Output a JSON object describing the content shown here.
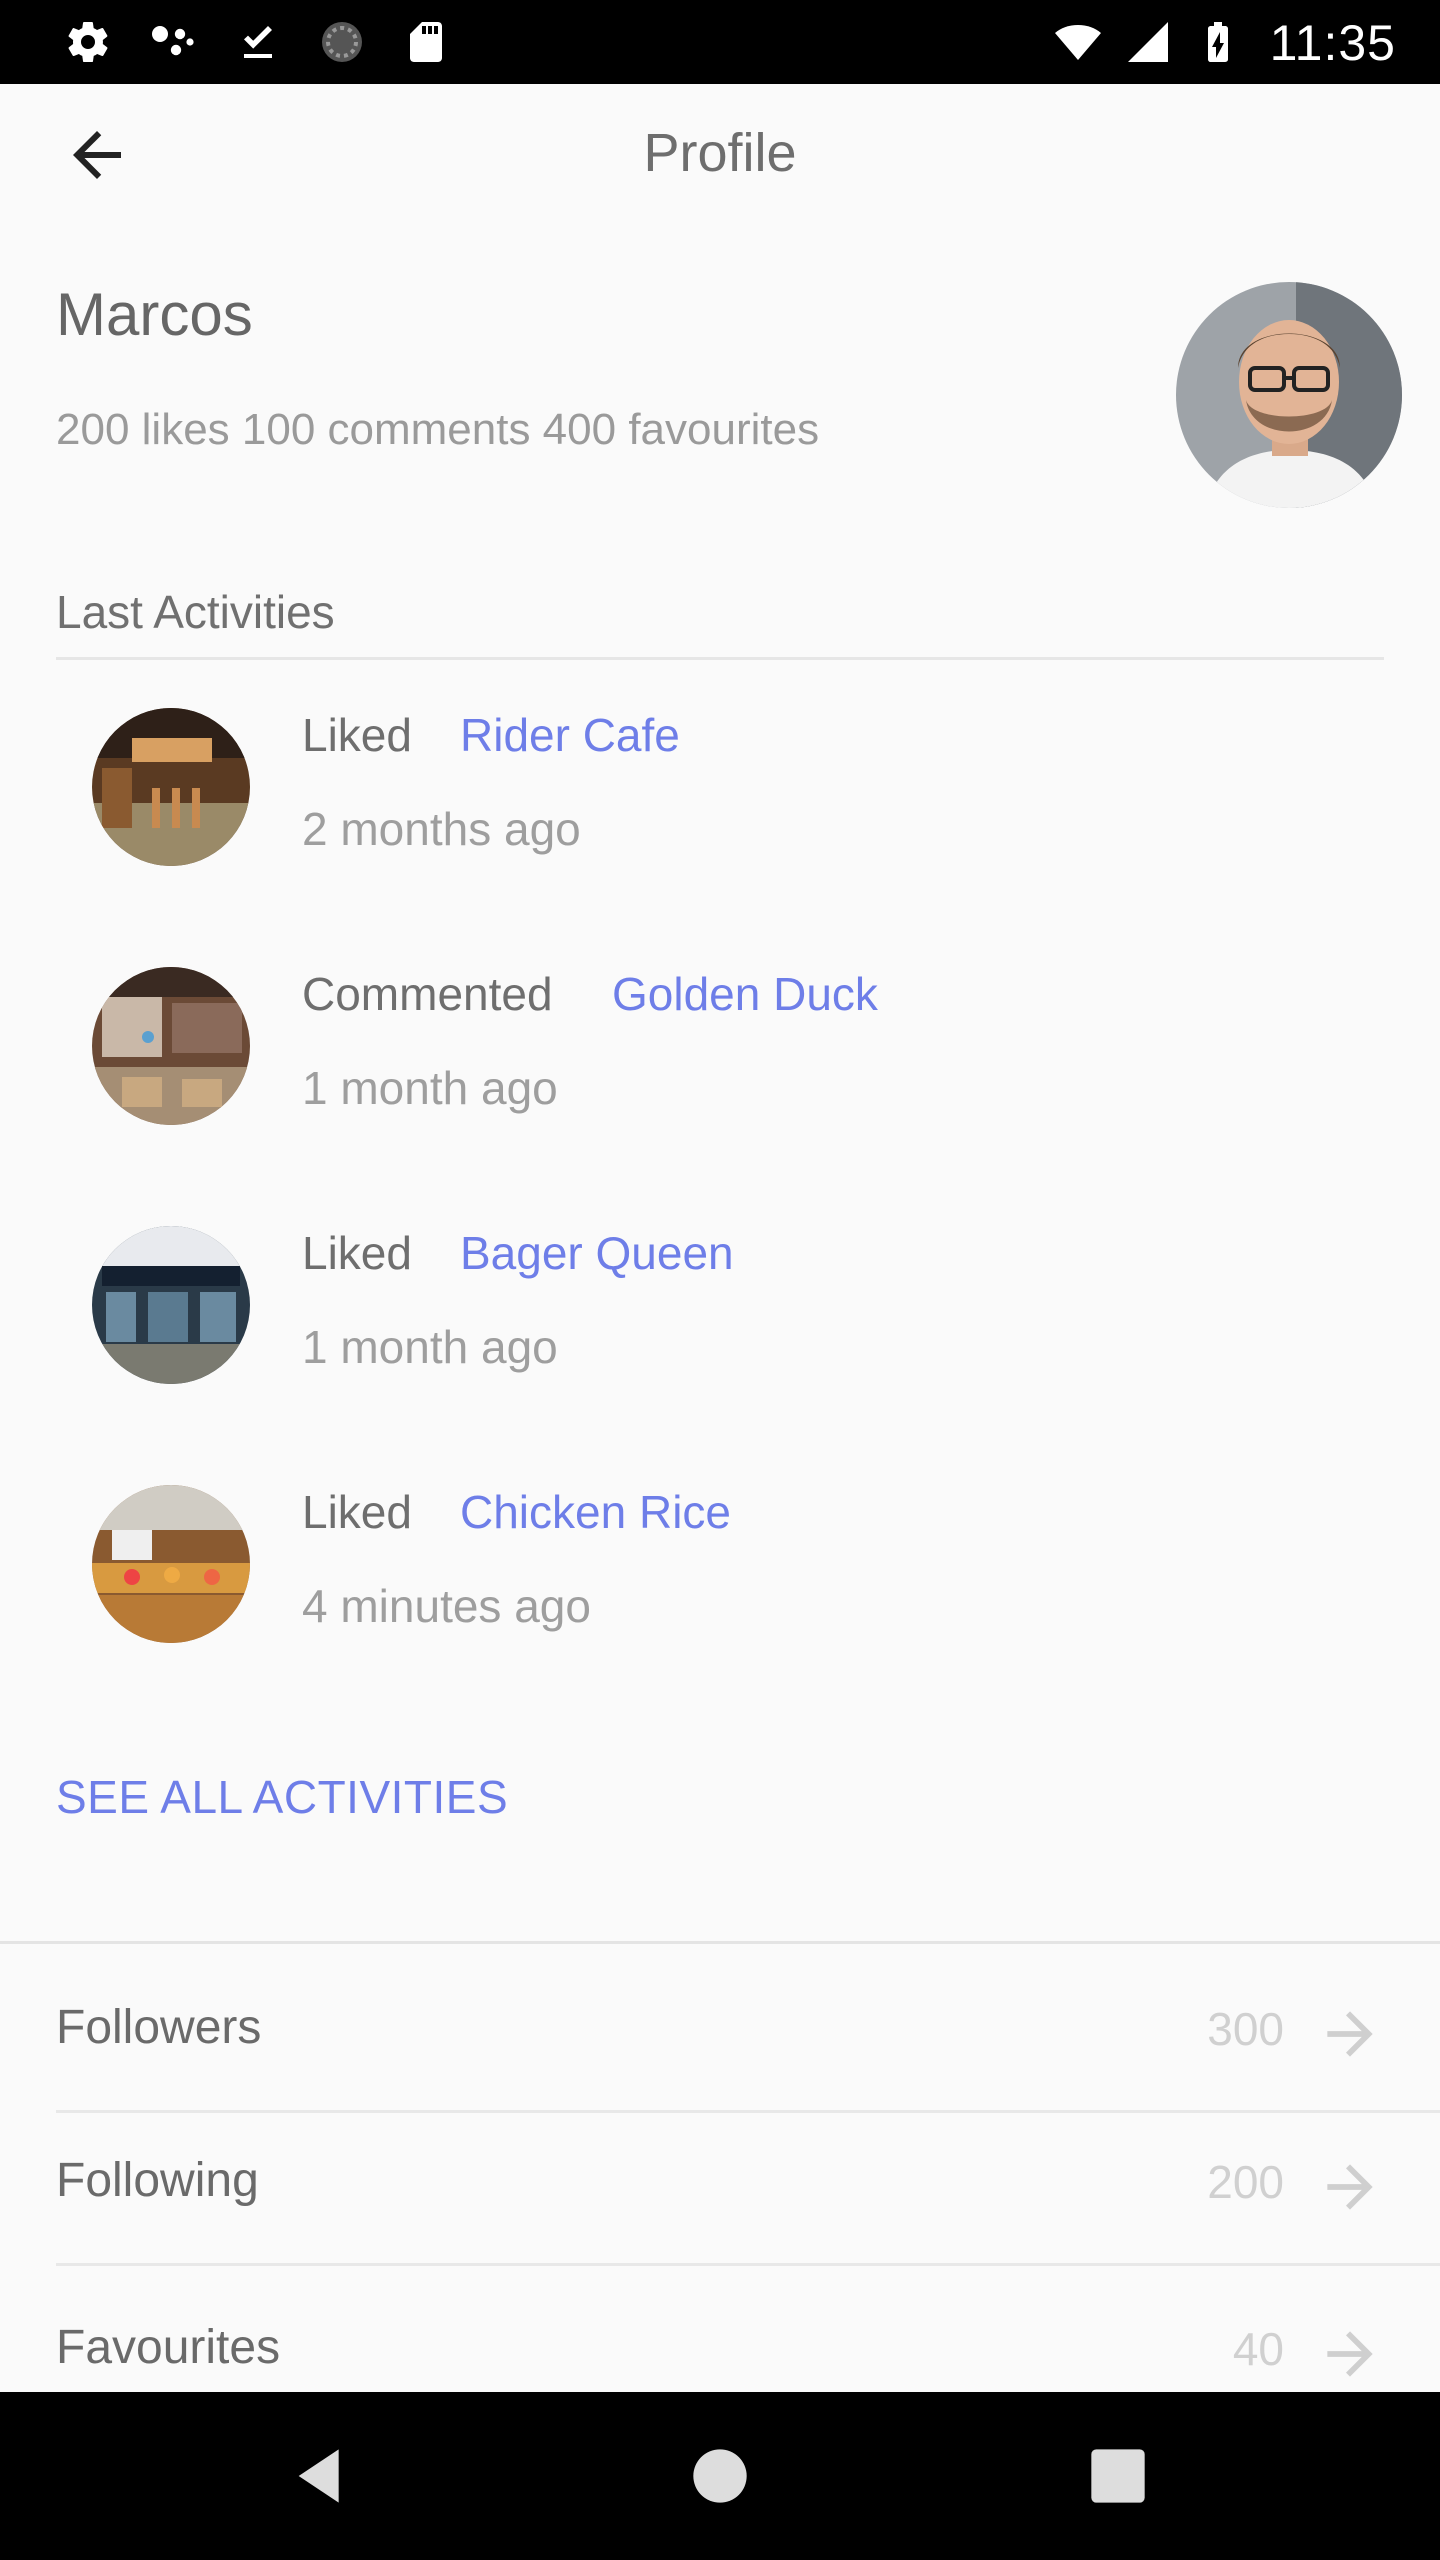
{
  "status_bar": {
    "time": "11:35",
    "icons": [
      "settings-icon",
      "assistant-dots-icon",
      "download-done-icon",
      "sync-circle-icon",
      "sd-card-icon",
      "wifi-icon",
      "cell-signal-icon",
      "battery-charging-icon"
    ]
  },
  "app_bar": {
    "title": "Profile",
    "back_icon": "arrow-back-icon"
  },
  "profile": {
    "name": "Marcos",
    "stats": "200 likes 100 comments 400 favourites"
  },
  "activities_section": {
    "title": "Last Activities",
    "items": [
      {
        "verb": "Liked",
        "target": "Rider Cafe",
        "time": "2 months ago"
      },
      {
        "verb": "Commented",
        "target": "Golden Duck",
        "time": "1 month ago"
      },
      {
        "verb": "Liked",
        "target": "Bager Queen",
        "time": "1 month ago"
      },
      {
        "verb": "Liked",
        "target": "Chicken Rice",
        "time": "4 minutes ago"
      }
    ],
    "see_all": "SEE ALL ACTIVITIES"
  },
  "stats_list": [
    {
      "label": "Followers",
      "count": "300"
    },
    {
      "label": "Following",
      "count": "200"
    },
    {
      "label": "Favourites",
      "count": "40"
    }
  ],
  "colors": {
    "accent": "#6e7ee8",
    "text": "#6b6b6b",
    "muted": "#9e9e9e",
    "background": "#fafafa"
  },
  "nav_bar": {
    "icons": [
      "back-triangle-icon",
      "home-circle-icon",
      "recents-square-icon"
    ]
  }
}
